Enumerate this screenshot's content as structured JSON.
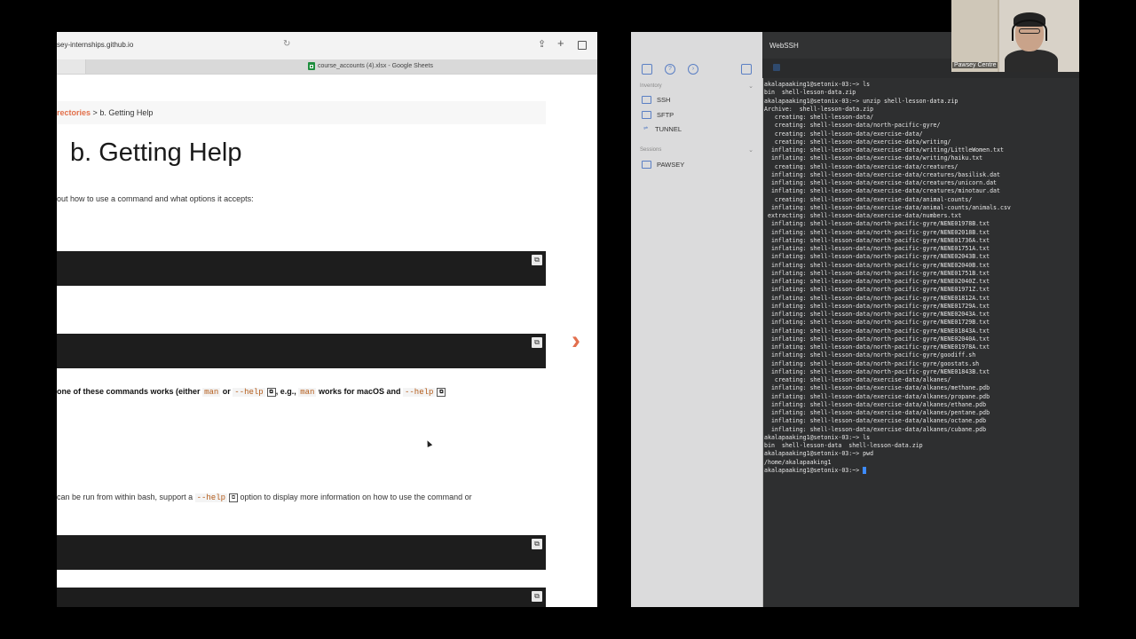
{
  "browser": {
    "url": "sey-internships.github.io",
    "tab_title": "course_accounts (4).xlsx - Google Sheets",
    "icons": {
      "reload": "reload-icon",
      "share": "share-icon",
      "new_tab": "plus-icon",
      "tabs": "tabs-icon"
    }
  },
  "page": {
    "breadcrumb_link": "rectories",
    "breadcrumb_sep": ">",
    "breadcrumb_current": "b. Getting Help",
    "title": "b. Getting Help",
    "intro": "out how to use a command and what options it accepts:",
    "help_line": {
      "pre": "one of these commands works (either",
      "code1": "man",
      "or": "or",
      "code2": "--help",
      "mid": ", e.g.,",
      "code3": "man",
      "post": "works for macOS and",
      "code4": "--help"
    },
    "bash_line": {
      "pre": "can be run from within bash, support a",
      "code": "--help",
      "post": "option to display more information on how to use the command or"
    },
    "next_arrow": "›"
  },
  "webssh": {
    "title": "WebSSH",
    "sidebar": {
      "inventory_label": "Inventory",
      "items": [
        "SSH",
        "SFTP",
        "TUNNEL"
      ],
      "sessions_label": "Sessions",
      "sessions": [
        "PAWSEY"
      ]
    },
    "terminal_lines": [
      "akalapaaking1@setonix-03:~> ls",
      "bin  shell-lesson-data.zip",
      "akalapaaking1@setonix-03:~> unzip shell-lesson-data.zip",
      "Archive:  shell-lesson-data.zip",
      "   creating: shell-lesson-data/",
      "   creating: shell-lesson-data/north-pacific-gyre/",
      "   creating: shell-lesson-data/exercise-data/",
      "   creating: shell-lesson-data/exercise-data/writing/",
      "  inflating: shell-lesson-data/exercise-data/writing/LittleWomen.txt",
      "  inflating: shell-lesson-data/exercise-data/writing/haiku.txt",
      "   creating: shell-lesson-data/exercise-data/creatures/",
      "  inflating: shell-lesson-data/exercise-data/creatures/basilisk.dat",
      "  inflating: shell-lesson-data/exercise-data/creatures/unicorn.dat",
      "  inflating: shell-lesson-data/exercise-data/creatures/minotaur.dat",
      "   creating: shell-lesson-data/exercise-data/animal-counts/",
      "  inflating: shell-lesson-data/exercise-data/animal-counts/animals.csv",
      " extracting: shell-lesson-data/exercise-data/numbers.txt",
      "  inflating: shell-lesson-data/north-pacific-gyre/NENE01978B.txt",
      "  inflating: shell-lesson-data/north-pacific-gyre/NENE02018B.txt",
      "  inflating: shell-lesson-data/north-pacific-gyre/NENE01736A.txt",
      "  inflating: shell-lesson-data/north-pacific-gyre/NENE01751A.txt",
      "  inflating: shell-lesson-data/north-pacific-gyre/NENE02043B.txt",
      "  inflating: shell-lesson-data/north-pacific-gyre/NENE02040B.txt",
      "  inflating: shell-lesson-data/north-pacific-gyre/NENE01751B.txt",
      "  inflating: shell-lesson-data/north-pacific-gyre/NENE02040Z.txt",
      "  inflating: shell-lesson-data/north-pacific-gyre/NENE01971Z.txt",
      "  inflating: shell-lesson-data/north-pacific-gyre/NENE01812A.txt",
      "  inflating: shell-lesson-data/north-pacific-gyre/NENE01729A.txt",
      "  inflating: shell-lesson-data/north-pacific-gyre/NENE02043A.txt",
      "  inflating: shell-lesson-data/north-pacific-gyre/NENE01729B.txt",
      "  inflating: shell-lesson-data/north-pacific-gyre/NENE01843A.txt",
      "  inflating: shell-lesson-data/north-pacific-gyre/NENE02040A.txt",
      "  inflating: shell-lesson-data/north-pacific-gyre/NENE01978A.txt",
      "  inflating: shell-lesson-data/north-pacific-gyre/goodiff.sh",
      "  inflating: shell-lesson-data/north-pacific-gyre/goostats.sh",
      "  inflating: shell-lesson-data/north-pacific-gyre/NENE01843B.txt",
      "   creating: shell-lesson-data/exercise-data/alkanes/",
      "  inflating: shell-lesson-data/exercise-data/alkanes/methane.pdb",
      "  inflating: shell-lesson-data/exercise-data/alkanes/propane.pdb",
      "  inflating: shell-lesson-data/exercise-data/alkanes/ethane.pdb",
      "  inflating: shell-lesson-data/exercise-data/alkanes/pentane.pdb",
      "  inflating: shell-lesson-data/exercise-data/alkanes/octane.pdb",
      "  inflating: shell-lesson-data/exercise-data/alkanes/cubane.pdb",
      "akalapaaking1@setonix-03:~> ls",
      "bin  shell-lesson-data  shell-lesson-data.zip",
      "akalapaaking1@setonix-03:~> pwd",
      "/home/akalapaaking1",
      "akalapaaking1@setonix-03:~> "
    ]
  },
  "webcam": {
    "label": "Pawsey Centre"
  },
  "colors": {
    "accent": "#e2704b",
    "code_bg": "#1d1d1d",
    "terminal_bg": "#2e2f30",
    "cursor": "#3d8bff"
  }
}
